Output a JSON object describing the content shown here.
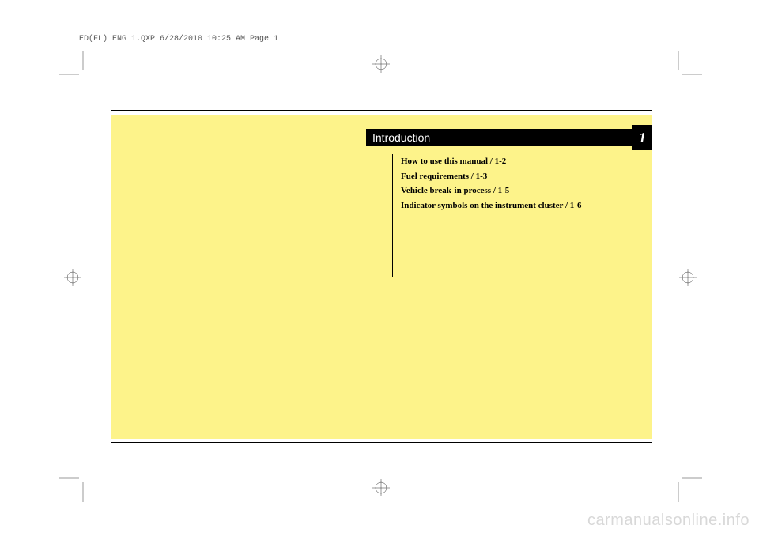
{
  "header": "ED(FL) ENG 1.QXP  6/28/2010  10:25 AM  Page 1",
  "chapter": {
    "title": "Introduction",
    "number": "1"
  },
  "toc": {
    "items": [
      "How to use this manual / 1-2",
      "Fuel requirements / 1-3",
      "Vehicle break-in process / 1-5",
      "Indicator symbols on the instrument cluster / 1-6"
    ]
  },
  "watermark": "carmanualsonline.info"
}
